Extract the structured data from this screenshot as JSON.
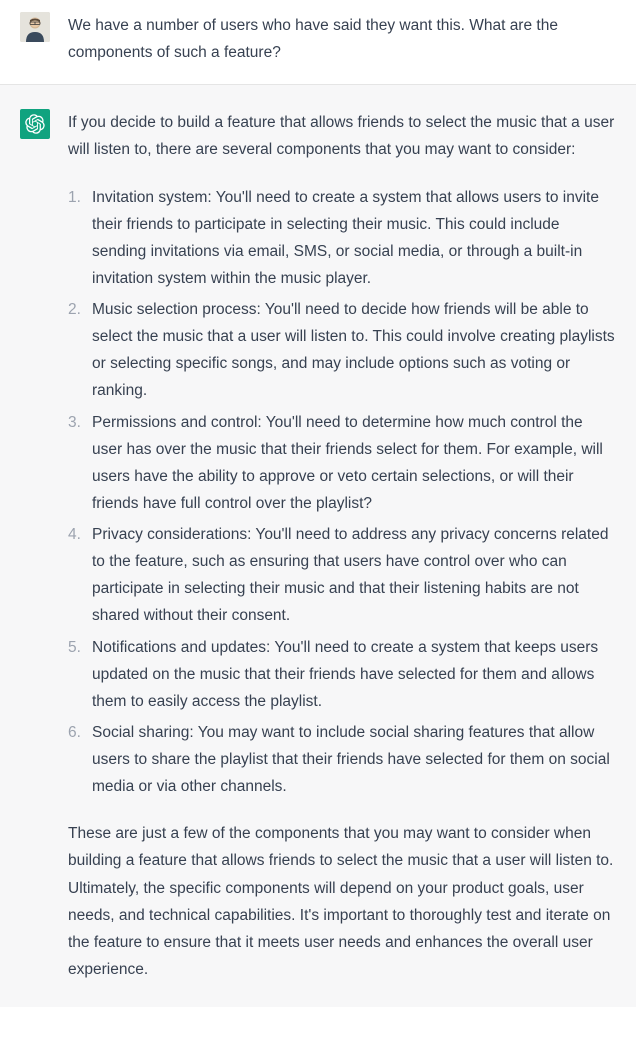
{
  "user_message": {
    "text": "We have a number of users who have said they want this. What are the components of such a feature?"
  },
  "assistant_message": {
    "intro": "If you decide to build a feature that allows friends to select the music that a user will listen to, there are several components that you may want to consider:",
    "list_items": [
      "Invitation system: You'll need to create a system that allows users to invite their friends to participate in selecting their music. This could include sending invitations via email, SMS, or social media, or through a built-in invitation system within the music player.",
      "Music selection process: You'll need to decide how friends will be able to select the music that a user will listen to. This could involve creating playlists or selecting specific songs, and may include options such as voting or ranking.",
      "Permissions and control: You'll need to determine how much control the user has over the music that their friends select for them. For example, will users have the ability to approve or veto certain selections, or will their friends have full control over the playlist?",
      "Privacy considerations: You'll need to address any privacy concerns related to the feature, such as ensuring that users have control over who can participate in selecting their music and that their listening habits are not shared without their consent.",
      "Notifications and updates: You'll need to create a system that keeps users updated on the music that their friends have selected for them and allows them to easily access the playlist.",
      "Social sharing: You may want to include social sharing features that allow users to share the playlist that their friends have selected for them on social media or via other channels."
    ],
    "outro": "These are just a few of the components that you may want to consider when building a feature that allows friends to select the music that a user will listen to. Ultimately, the specific components will depend on your product goals, user needs, and technical capabilities. It's important to thoroughly test and iterate on the feature to ensure that it meets user needs and enhances the overall user experience."
  }
}
